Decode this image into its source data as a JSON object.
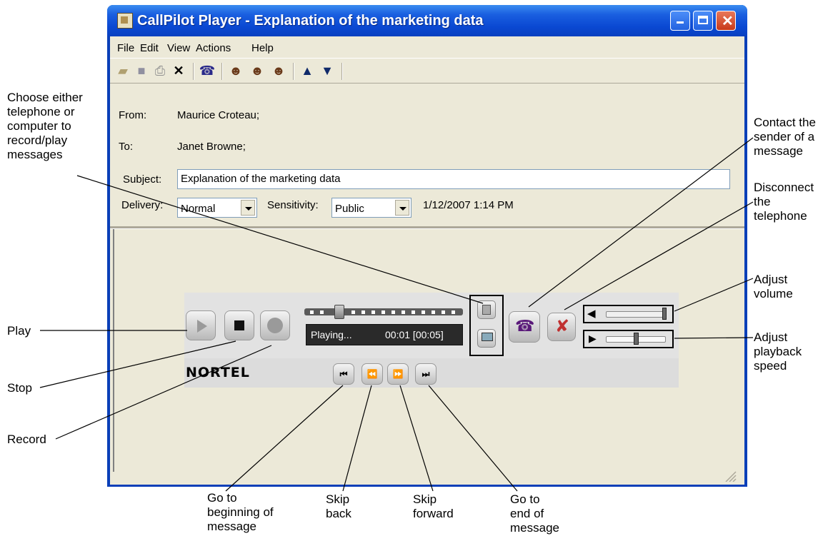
{
  "window": {
    "title": "CallPilot Player - Explanation of the marketing data"
  },
  "menu": [
    "File",
    "Edit",
    "View",
    "Actions",
    "Help"
  ],
  "header": {
    "from_label": "From:",
    "from_value": "Maurice Croteau;",
    "to_label": "To:",
    "to_value": "Janet Browne;",
    "subject_label": "Subject:",
    "subject_value": "Explanation of the marketing data",
    "delivery_label": "Delivery:",
    "delivery_value": "Normal",
    "sensitivity_label": "Sensitivity:",
    "sensitivity_value": "Public",
    "timestamp": "1/12/2007 1:14 PM"
  },
  "player": {
    "status_text": "Playing...",
    "time_text": "00:01 [00:05]",
    "brand": "NORTEL"
  },
  "callouts": {
    "choose": [
      "Choose either",
      "telephone or",
      "computer to",
      "record/play",
      "messages"
    ],
    "play": "Play",
    "stop": "Stop",
    "record": "Record",
    "contact": [
      "Contact the",
      "sender of a",
      "message"
    ],
    "disconnect": [
      "Disconnect",
      "the",
      "telephone"
    ],
    "volume": [
      "Adjust",
      "volume"
    ],
    "speed": [
      "Adjust",
      "playback",
      "speed"
    ],
    "go_begin": [
      "Go to",
      "beginning of",
      "message"
    ],
    "skip_back": [
      "Skip",
      "back"
    ],
    "skip_forward": [
      "Skip",
      "forward"
    ],
    "go_end": [
      "Go to",
      "end of",
      "message"
    ]
  },
  "colors": {
    "title_blue": "#0a48d2",
    "window_bg": "#ece9d8",
    "close_red": "#c83a1a",
    "status_bg": "#2a2a2a"
  }
}
